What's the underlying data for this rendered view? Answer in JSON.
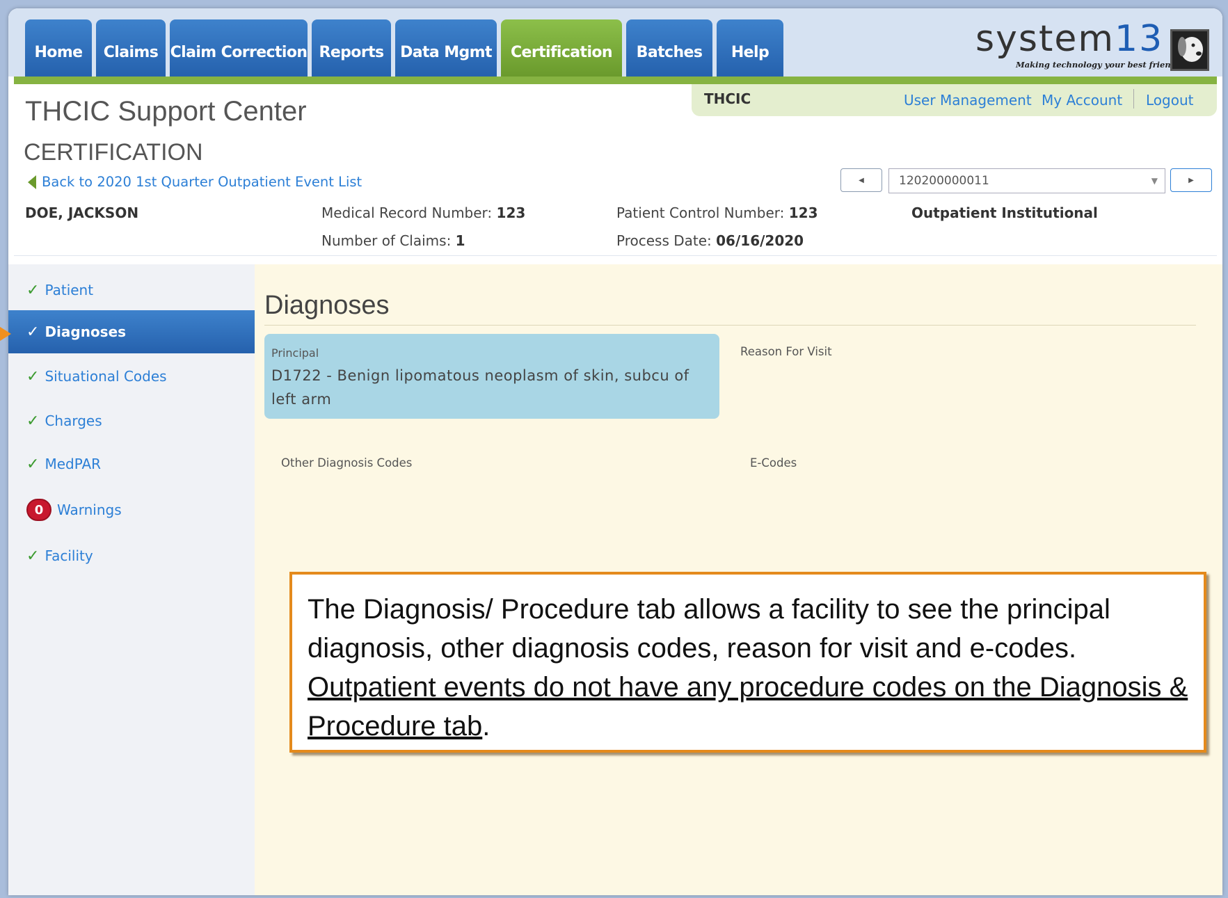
{
  "nav": {
    "tabs": [
      {
        "label": "Home",
        "active": false
      },
      {
        "label": "Claims",
        "active": false
      },
      {
        "label": "Claim Correction",
        "active": false
      },
      {
        "label": "Reports",
        "active": false
      },
      {
        "label": "Data Mgmt",
        "active": false
      },
      {
        "label": "Certification",
        "active": true
      },
      {
        "label": "Batches",
        "active": false
      },
      {
        "label": "Help",
        "active": false
      }
    ]
  },
  "logo": {
    "word": "system",
    "number": "13",
    "tagline": "Making technology your best friend."
  },
  "header": {
    "org": "THCIC",
    "links": [
      "User Management",
      "My Account",
      "Logout"
    ],
    "app_title": "THCIC Support Center",
    "section_title": "CERTIFICATION",
    "back_link": "Back to 2020 1st Quarter Outpatient Event List",
    "claim_selector": {
      "value": "120200000011"
    }
  },
  "patient": {
    "name": "DOE, JACKSON",
    "mrn_label": "Medical Record Number:",
    "mrn": "123",
    "claims_label": "Number of Claims:",
    "claims": "1",
    "pcn_label": "Patient Control Number:",
    "pcn": "123",
    "process_label": "Process Date:",
    "process_date": "06/16/2020",
    "claim_type": "Outpatient Institutional"
  },
  "sidebar": {
    "items": [
      {
        "label": "Patient",
        "active": false
      },
      {
        "label": "Diagnoses",
        "active": true
      },
      {
        "label": "Situational Codes",
        "active": false
      },
      {
        "label": "Charges",
        "active": false
      },
      {
        "label": "MedPAR",
        "active": false
      },
      {
        "label": "Warnings",
        "badge": "0",
        "active": false
      },
      {
        "label": "Facility",
        "active": false
      }
    ]
  },
  "main": {
    "heading": "Diagnoses",
    "principal_label": "Principal",
    "principal_value": "D1722 - Benign lipomatous neoplasm of skin, subcu of left arm",
    "reason_label": "Reason For Visit",
    "other_label": "Other Diagnosis Codes",
    "ecodes_label": "E-Codes"
  },
  "callout": {
    "text_plain": "The Diagnosis/ Procedure tab allows a facility to see the principal diagnosis, other diagnosis codes, reason for visit and e-codes.",
    "text_underlined": "Outpatient events do not have any procedure codes on the Diagnosis & Procedure tab",
    "text_end": "."
  },
  "colors": {
    "nav_blue": "#2561ad",
    "nav_green": "#6a9a2c",
    "link_blue": "#2c7fd6",
    "callout_border": "#e48a1c",
    "badge_red": "#c8182e"
  }
}
